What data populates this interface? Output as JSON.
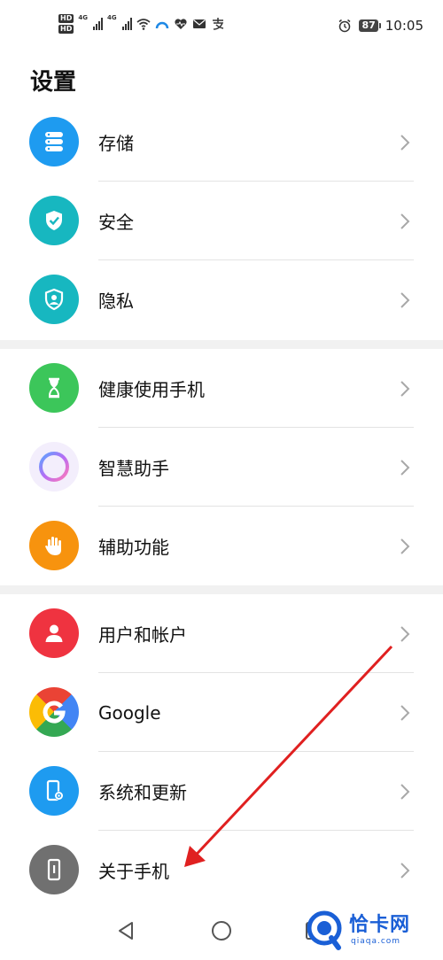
{
  "status_bar": {
    "hd_label": "HD",
    "signal_label": "4G",
    "battery": "87",
    "time": "10:05"
  },
  "page_title": "设置",
  "groups": [
    {
      "items": [
        {
          "label": "存储",
          "icon": "storage-icon",
          "color": "#1e9bf0"
        },
        {
          "label": "安全",
          "icon": "shield-check-icon",
          "color": "#17b7c0"
        },
        {
          "label": "隐私",
          "icon": "privacy-shield-icon",
          "color": "#17b7c0"
        }
      ]
    },
    {
      "items": [
        {
          "label": "健康使用手机",
          "icon": "hourglass-icon",
          "color": "#3cc65a"
        },
        {
          "label": "智慧助手",
          "icon": "assistant-ring-icon",
          "color": "#9b6cf5"
        },
        {
          "label": "辅助功能",
          "icon": "hand-icon",
          "color": "#f7930e"
        }
      ]
    },
    {
      "items": [
        {
          "label": "用户和帐户",
          "icon": "user-icon",
          "color": "#ef3340"
        },
        {
          "label": "Google",
          "icon": "google-icon",
          "color": "#4285f4"
        },
        {
          "label": "系统和更新",
          "icon": "phone-settings-icon",
          "color": "#1e9bf0"
        },
        {
          "label": "关于手机",
          "icon": "phone-info-icon",
          "color": "#707070"
        }
      ]
    }
  ],
  "watermark": {
    "text": "恰卡网",
    "sub": "qiaqa.com"
  }
}
